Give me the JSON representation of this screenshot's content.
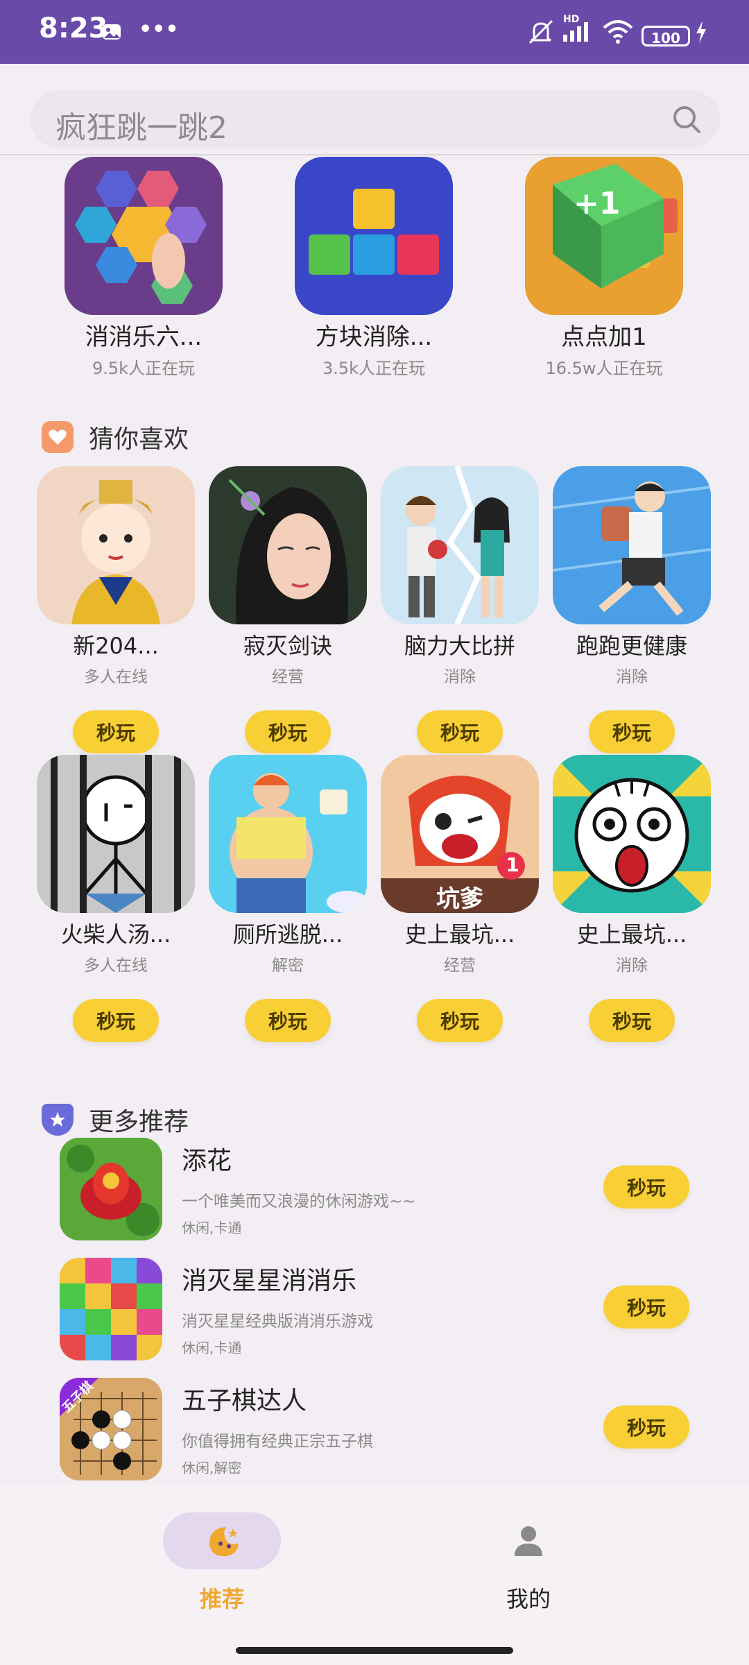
{
  "status_bar": {
    "time": "8:23",
    "overflow": "•••",
    "network": "HD",
    "battery": "100"
  },
  "search": {
    "placeholder": "疯狂跳一跳2"
  },
  "top_games": [
    {
      "name": "消消乐六...",
      "players": "9.5k人正在玩"
    },
    {
      "name": "方块消除...",
      "players": "3.5k人正在玩"
    },
    {
      "name": "点点加1",
      "players": "16.5w人正在玩"
    }
  ],
  "guess_section": {
    "title": "猜你喜欢",
    "items": [
      {
        "name": "新204...",
        "tag": "多人在线",
        "button": "秒玩"
      },
      {
        "name": "寂灭剑诀",
        "tag": "经营",
        "button": "秒玩"
      },
      {
        "name": "脑力大比拼",
        "tag": "消除",
        "button": "秒玩"
      },
      {
        "name": "跑跑更健康",
        "tag": "消除",
        "button": "秒玩"
      },
      {
        "name": "火柴人汤...",
        "tag": "多人在线",
        "button": "秒玩"
      },
      {
        "name": "厕所逃脱...",
        "tag": "解密",
        "button": "秒玩"
      },
      {
        "name": "史上最坑...",
        "tag": "经营",
        "button": "秒玩",
        "icon_text": "坑爹",
        "icon_badge": "1"
      },
      {
        "name": "史上最坑...",
        "tag": "消除",
        "button": "秒玩"
      }
    ]
  },
  "more_section": {
    "title": "更多推荐",
    "items": [
      {
        "title": "添花",
        "desc": "一个唯美而又浪漫的休闲游戏~~",
        "tags": "休闲,卡通",
        "button": "秒玩"
      },
      {
        "title": "消灭星星消消乐",
        "desc": "消灭星星经典版消消乐游戏",
        "tags": "休闲,卡通",
        "button": "秒玩"
      },
      {
        "title": "五子棋达人",
        "desc": "你值得拥有经典正宗五子棋",
        "tags": "休闲,解密",
        "button": "秒玩",
        "icon_text": "五子棋"
      }
    ]
  },
  "bottom_nav": {
    "tabs": [
      {
        "label": "推荐",
        "active": true
      },
      {
        "label": "我的",
        "active": false
      }
    ]
  },
  "colors": {
    "status_bar": "#6a4aa8",
    "accent_button": "#f8cf34",
    "active_tab": "#f0a830"
  }
}
